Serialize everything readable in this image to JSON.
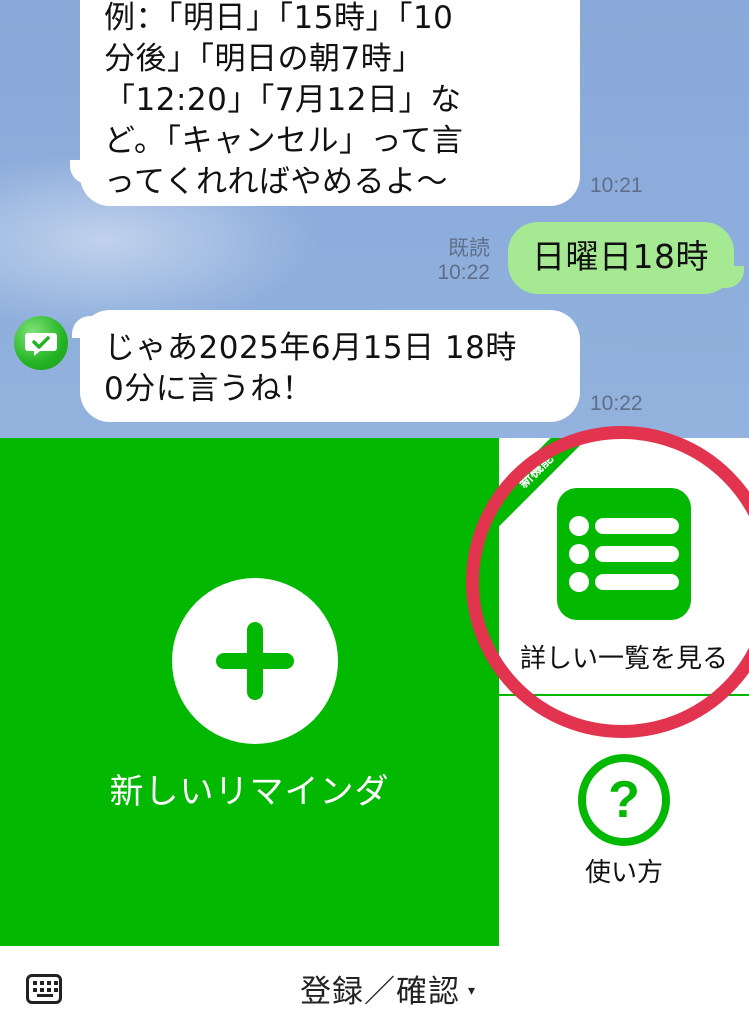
{
  "chat": {
    "messages": [
      {
        "sender": "bot",
        "text": "例：「明日」「15時」「10\n分後」「明日の朝7時」\n「12:20」「7月12日」な\nど。「キャンセル」って言\nってくれればやめるよ〜",
        "time": "10:21"
      },
      {
        "sender": "user",
        "text": "日曜日18時",
        "read_label": "既読",
        "time": "10:22"
      },
      {
        "sender": "bot",
        "text": "じゃあ2025年6月15日 18時\n0分に言うね！",
        "time": "10:22"
      }
    ]
  },
  "rich_menu": {
    "new_reminder": {
      "label": "新しいリマインダ",
      "icon": "plus-icon"
    },
    "list": {
      "label": "詳しい一覧を見る",
      "badge": "新機能",
      "icon": "list-icon"
    },
    "help": {
      "label": "使い方",
      "icon": "question-icon",
      "symbol": "?"
    }
  },
  "bottom_bar": {
    "menu_label": "登録／確認",
    "caret": "▾",
    "keyboard_icon": "keyboard-icon"
  },
  "colors": {
    "line_green": "#02b801",
    "user_bubble": "#a6e993",
    "chat_background": "#8daddc",
    "highlight_ring": "#e2334f"
  }
}
